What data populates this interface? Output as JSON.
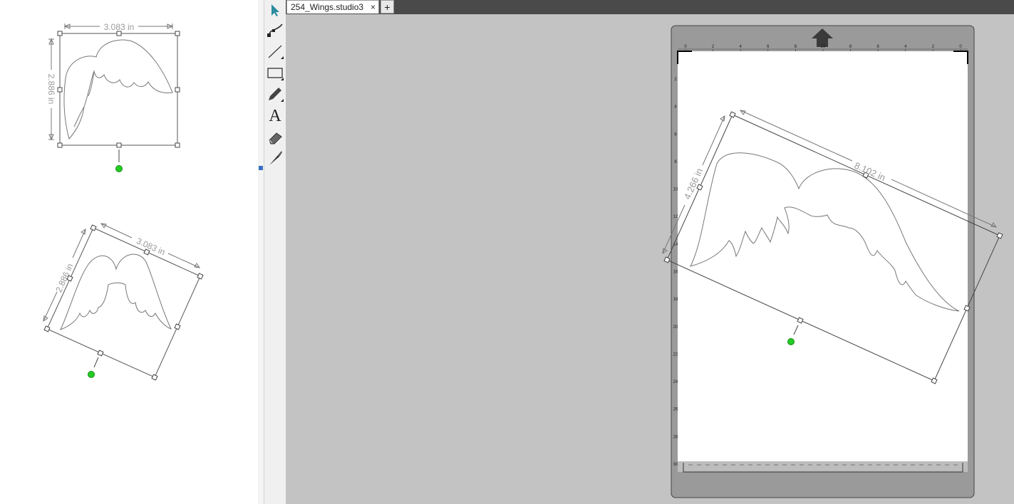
{
  "tabs": {
    "document_name": "254_Wings.studio3",
    "close_glyph": "×",
    "add_glyph": "+"
  },
  "tools": [
    {
      "name": "select-tool",
      "icon": "arrow-pointer-icon"
    },
    {
      "name": "point-edit-tool",
      "icon": "bezier-curve-icon"
    },
    {
      "name": "line-tool",
      "icon": "line-icon"
    },
    {
      "name": "rectangle-tool",
      "icon": "rectangle-icon"
    },
    {
      "name": "pencil-tool",
      "icon": "pencil-icon"
    },
    {
      "name": "text-tool",
      "icon": "text-icon",
      "glyph": "A"
    },
    {
      "name": "eraser-tool",
      "icon": "eraser-icon"
    },
    {
      "name": "knife-tool",
      "icon": "knife-icon"
    }
  ],
  "left_panel": {
    "wing_upright": {
      "width_label": "3.083 in",
      "height_label": "2.886 in"
    },
    "wing_rotated": {
      "width_label": "3.083 in",
      "height_label": "2.886 in"
    }
  },
  "mat": {
    "top_ruler": [
      "0",
      "2",
      "4",
      "6",
      "8",
      "10",
      "8",
      "6",
      "4",
      "2",
      "0"
    ],
    "left_ruler": [
      "2",
      "4",
      "6",
      "8",
      "10",
      "12",
      "14",
      "16",
      "18",
      "20",
      "22",
      "24",
      "26",
      "28",
      "30"
    ],
    "selection": {
      "width_label": "8.102 in",
      "height_label": "4.266 in"
    },
    "feed_arrow_icon": "up-arrow-icon"
  },
  "colors": {
    "rotation_handle": "#22cc22",
    "selected_tool": "#2a8c9e",
    "tab_bar": "#4a4a4a",
    "canvas": "#c3c3c3",
    "mat": "#9a9a9a"
  }
}
